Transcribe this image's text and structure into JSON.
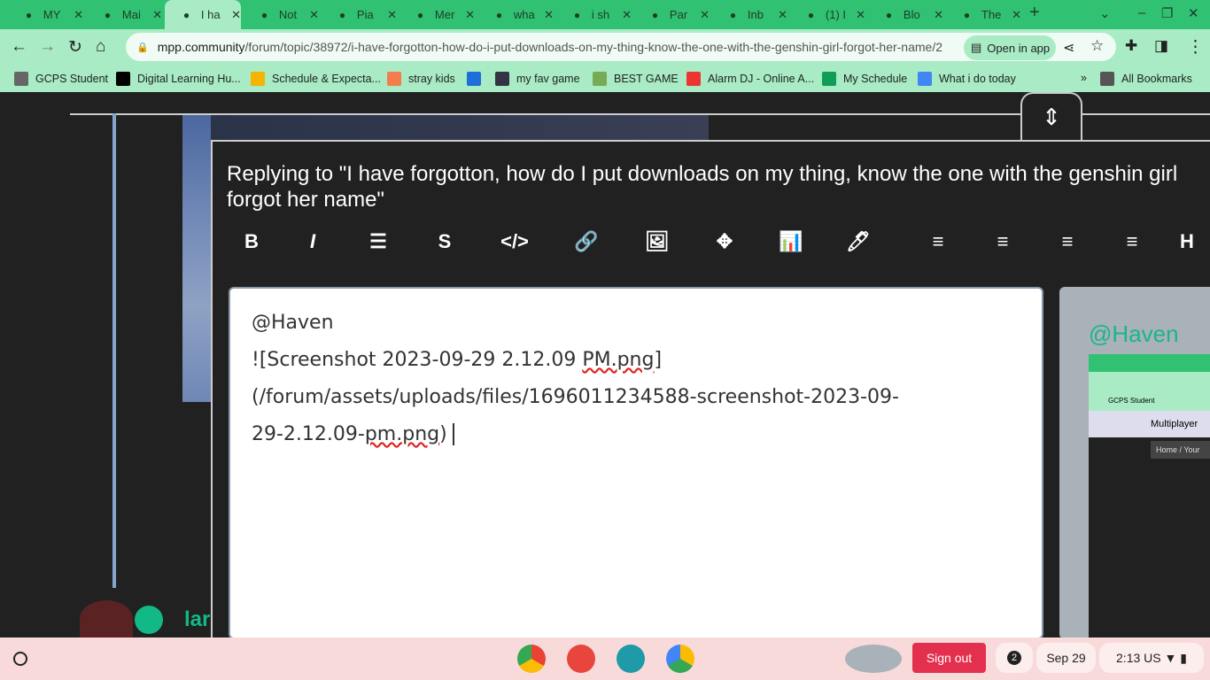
{
  "tabs": [
    {
      "title": "MY",
      "icon": "school-icon"
    },
    {
      "title": "Mai",
      "icon": "d2l-icon"
    },
    {
      "title": "I ha",
      "icon": "music-note-icon",
      "active": true
    },
    {
      "title": "Not",
      "icon": "face-icon"
    },
    {
      "title": "Pia",
      "icon": "piano-icon"
    },
    {
      "title": "Mer",
      "icon": "red-app-icon"
    },
    {
      "title": "wha",
      "icon": "google-icon"
    },
    {
      "title": "i sh",
      "icon": "google-icon"
    },
    {
      "title": "Par",
      "icon": "smile-icon"
    },
    {
      "title": "Inb",
      "icon": "gmail-icon"
    },
    {
      "title": "(1) I",
      "icon": "anime-icon"
    },
    {
      "title": "Blo",
      "icon": "settings-circle-icon"
    },
    {
      "title": "The",
      "icon": "blue-d-icon"
    }
  ],
  "address": {
    "host": "mpp.community",
    "path": "/forum/topic/38972/i-have-forgotton-how-do-i-put-downloads-on-my-thing-know-the-one-with-the-genshin-girl-forgot-her-name/2",
    "open_in_app": "Open in app"
  },
  "bookmarks": [
    "GCPS Student",
    "Digital Learning Hu...",
    "Schedule & Expecta...",
    "stray kids",
    "",
    "my fav game",
    "BEST GAME",
    "Alarm DJ - Online A...",
    "My Schedule",
    "What i do today"
  ],
  "all_bookmarks": "All Bookmarks",
  "composer": {
    "replying": "Replying to \"I have forgotton, how do I put downloads on my thing, know the one with the genshin girl forgot her name\"",
    "toolbar": [
      "B",
      "I",
      "☰",
      "S",
      "</>",
      "🔗",
      "🖼",
      "✥",
      "📊",
      "🖊",
      "≡",
      "≡",
      "≡",
      "≡",
      "H"
    ],
    "text": {
      "l1": "@Haven",
      "l2a": "![Screenshot 2023-09-29 2.12.09 ",
      "l2b": "PM.png",
      "l2c": "]",
      "l3": "(/forum/assets/uploads/files/1696011234588-screenshot-2023-09-",
      "l4a": "29-2.12.09-",
      "l4b": "pm.png",
      "l4c": ")"
    },
    "preview": {
      "name": "@Haven",
      "shot_title": "Multiplayer",
      "breadcrumb": "Home / Your",
      "bm": "GCPS Student"
    }
  },
  "user_partial": "lar",
  "shelf": {
    "sign_out": "Sign out",
    "notifications": "2",
    "date": "Sep 29",
    "time": "2:13",
    "locale": "US",
    "accent": "#e3304f"
  }
}
